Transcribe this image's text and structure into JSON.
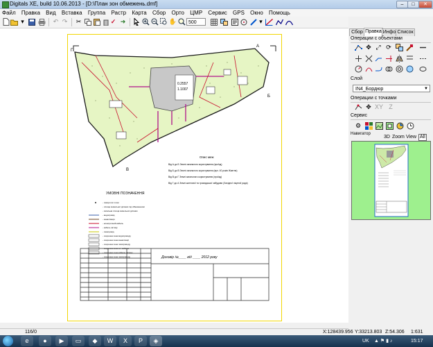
{
  "window": {
    "title": "Digitals XE, build 10.06.2013 - [D:\\План зон обмежень.dmf]",
    "buttons": {
      "minimize": "–",
      "maximize": "□",
      "close": "✕"
    }
  },
  "menu": [
    "Файл",
    "Правка",
    "Вид",
    "Вставка",
    "Группа",
    "Растр",
    "Карта",
    "Сбор",
    "Орто",
    "ЦМР",
    "Сервис",
    "GPS",
    "Окно",
    "Помощь"
  ],
  "toolbar": {
    "scale_value": "500"
  },
  "panel": {
    "tabs": [
      "Сбор",
      "Правка",
      "Инфо",
      "Список"
    ],
    "active_tab": "Правка",
    "section_objects": "Операции с объектами",
    "section_layer": "Слой",
    "layer_value": "IN4_Бордюр",
    "section_points": "Операции с точками",
    "section_service": "Сервис",
    "navigator_label": "Навигатор",
    "navigator_tabs": [
      "3D",
      "Zoom",
      "View",
      "All"
    ]
  },
  "drawing": {
    "area_label_1": "0.2557",
    "area_label_2": "1.1007",
    "corner_a": "А",
    "corner_b": "Б",
    "corner_v": "В",
    "corner_g": "Г",
    "explication_title": "Опис меж",
    "explication_rows": [
      "Від А до Б  Землі загального користування (проїзд)",
      "Від Б до В  Землі загального користування (вул. 40 років Жовтня)",
      "Від В до Г  Землі загального користування (проїзд)",
      "Від Г до А  Землі житлової та громадської забудови (Західної ліцензії ради)"
    ],
    "legend_title": "УМОВНІ ПОЗНАЧЕННЯ",
    "legend_rows": [
      "- поворотні точки",
      "- площа земельної ділянки під обмеженням",
      "- загальна площа земельної ділянки",
      "- водопровід",
      "- каналізація",
      "- електричний кабель",
      "- кабель зв'язку",
      "- газопровід",
      "- охоронна зона водопроводу",
      "- охоронна зона каналізації",
      "- охоронна зона газопроводу",
      "- охоронна зона ел. кабелю",
      "- охоронна зона кабелю зв'язку",
      "- охоронна зона газопроводу"
    ],
    "stamp_text": "Договір №____ від ____ 2012 року"
  },
  "status": {
    "left": "116/0",
    "x": "X:128439.956",
    "y": "Y:33213.803",
    "z": "Z:54.306",
    "scale": "1:631"
  },
  "taskbar": {
    "lang": "UK",
    "time": "15:17"
  },
  "colors": {
    "plot_fill": "#e6f5c4",
    "building": "#c8c8c8",
    "boundary": "#1a1a1a",
    "utility_red": "#c8102e",
    "utility_magenta": "#b0118a",
    "navigator_bg": "#9ef08e"
  }
}
